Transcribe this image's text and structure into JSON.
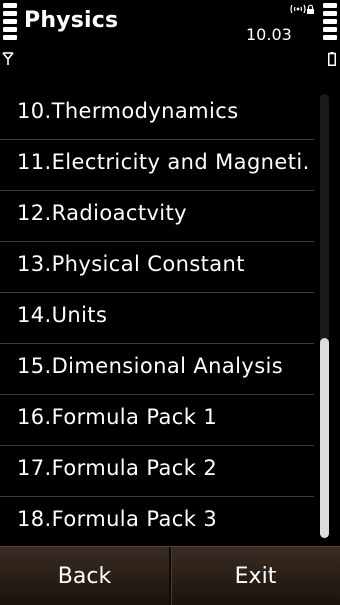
{
  "header": {
    "title": "Physics",
    "clock": "10.03",
    "signal_icon": "signal-strength-icon",
    "battery_icon": "battery-level-icon"
  },
  "list": {
    "items": [
      {
        "label": "10.Thermodynamics"
      },
      {
        "label": "11.Electricity and Magneti..."
      },
      {
        "label": "12.Radioactvity"
      },
      {
        "label": "13.Physical Constant"
      },
      {
        "label": "14.Units"
      },
      {
        "label": "15.Dimensional Analysis"
      },
      {
        "label": "16.Formula Pack 1"
      },
      {
        "label": "17.Formula Pack 2"
      },
      {
        "label": "18.Formula Pack 3"
      }
    ]
  },
  "scrollbar": {
    "visible_fraction": 0.45,
    "position_fraction": 1.0
  },
  "softkeys": {
    "left_label": "Back",
    "right_label": "Exit"
  },
  "colors": {
    "background": "#000000",
    "text": "#ffffff",
    "softkey_bar": "#2c2018"
  }
}
